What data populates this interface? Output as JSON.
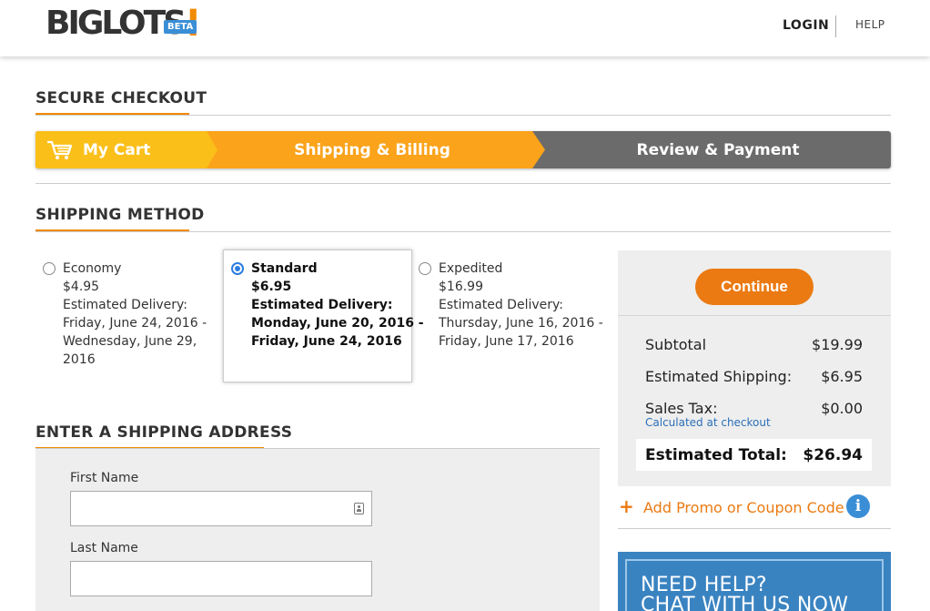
{
  "header": {
    "logo_text": "BIGLOTS",
    "logo_mark": "!",
    "beta_badge": "BETA",
    "login": "LOGIN",
    "help": "HELP"
  },
  "checkout": {
    "title": "SECURE CHECKOUT",
    "steps": [
      {
        "label": "My Cart",
        "icon": "cart-icon",
        "color": "#fbbf1a"
      },
      {
        "label": "Shipping & Billing",
        "color": "#fba31a"
      },
      {
        "label": "Review & Payment",
        "color": "#6b6b6b"
      }
    ]
  },
  "shipping_method": {
    "title": "SHIPPING METHOD",
    "options": [
      {
        "name": "Economy",
        "price": "$4.95",
        "delivery_label": "Estimated Delivery:",
        "delivery_lines": [
          "Friday, June 24, 2016 -",
          "Wednesday, June 29,",
          "2016"
        ],
        "selected": false
      },
      {
        "name": "Standard",
        "price": "$6.95",
        "delivery_label": "Estimated Delivery:",
        "delivery_lines": [
          "Monday, June 20, 2016 -",
          "Friday, June 24, 2016"
        ],
        "selected": true
      },
      {
        "name": "Expedited",
        "price": "$16.99",
        "delivery_label": "Estimated Delivery:",
        "delivery_lines": [
          "Thursday, June 16, 2016 -",
          "Friday, June 17, 2016"
        ],
        "selected": false
      }
    ]
  },
  "address": {
    "title": "ENTER A SHIPPING ADDRESS",
    "first_name_label": "First Name",
    "first_name_value": "",
    "last_name_label": "Last Name",
    "last_name_value": ""
  },
  "summary": {
    "continue": "Continue",
    "subtotal_label": "Subtotal",
    "subtotal_value": "$19.99",
    "shipping_label": "Estimated Shipping:",
    "shipping_value": "$6.95",
    "tax_label": "Sales Tax:",
    "tax_value": "$0.00",
    "tax_note": "Calculated at checkout",
    "total_label": "Estimated Total:",
    "total_value": "$26.94"
  },
  "promo": {
    "plus": "+",
    "label": "Add Promo or Coupon Code",
    "info": "i"
  },
  "help_panel": {
    "line1": "NEED HELP?",
    "line2": "CHAT WITH US NOW"
  },
  "colors": {
    "accent": "#f08a00",
    "button": "#eb7a12",
    "link": "#2a6fb8"
  }
}
